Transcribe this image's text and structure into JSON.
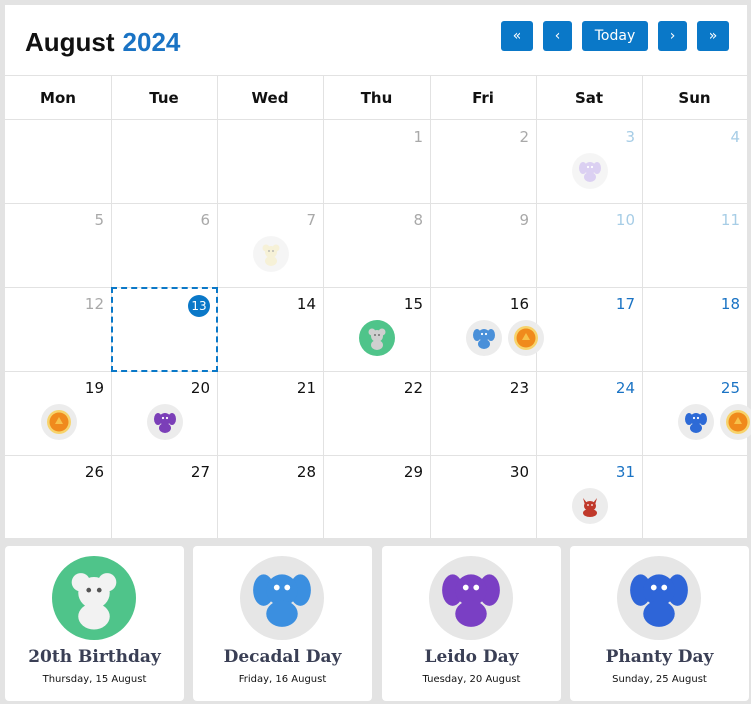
{
  "header": {
    "month": "August",
    "year": "2024",
    "buttons": {
      "first": "«",
      "prev": "‹",
      "today": "Today",
      "next": "›",
      "last": "»"
    }
  },
  "weekdays": [
    "Mon",
    "Tue",
    "Wed",
    "Thu",
    "Fri",
    "Sat",
    "Sun"
  ],
  "today_day": 13,
  "weeks": [
    [
      null,
      null,
      null,
      1,
      2,
      3,
      4
    ],
    [
      5,
      6,
      7,
      8,
      9,
      10,
      11
    ],
    [
      12,
      13,
      14,
      15,
      16,
      17,
      18
    ],
    [
      19,
      20,
      21,
      22,
      23,
      24,
      25
    ],
    [
      26,
      27,
      28,
      29,
      30,
      31,
      null
    ]
  ],
  "events": [
    {
      "day": 3,
      "icon": "purple-pet-icon",
      "color": "#b9a2e6"
    },
    {
      "day": 7,
      "icon": "yellow-bear-icon",
      "color": "#efe4b0"
    },
    {
      "day": 15,
      "icon": "bear-icon",
      "color": "#cfcfcf",
      "bg": "#4fc48a"
    },
    {
      "day": 16,
      "icon": "blue-pet-icon",
      "color": "#4a90d9"
    },
    {
      "day": 16,
      "icon": "orange-orb-icon",
      "color": "#f08a1c"
    },
    {
      "day": 19,
      "icon": "orange-orb-icon",
      "color": "#f08a1c"
    },
    {
      "day": 20,
      "icon": "purple-pet-icon",
      "color": "#7b3fb8"
    },
    {
      "day": 25,
      "icon": "blue-pet-icon",
      "color": "#2d6ad6"
    },
    {
      "day": 25,
      "icon": "orange-orb-icon",
      "color": "#f08a1c"
    },
    {
      "day": 31,
      "icon": "red-pet-icon",
      "color": "#c0392b"
    }
  ],
  "cards": [
    {
      "title": "20th Birthday",
      "date": "Thursday, 15 August",
      "icon": "bear-icon",
      "bg": "#4fc48a",
      "color": "#f2f2f2"
    },
    {
      "title": "Decadal Day",
      "date": "Friday, 16 August",
      "icon": "blue-pet-icon",
      "bg": "#e6e6e6",
      "color": "#3b8fe0"
    },
    {
      "title": "Leido Day",
      "date": "Tuesday, 20 August",
      "icon": "purple-pet-icon",
      "bg": "#e6e6e6",
      "color": "#7a3fc4"
    },
    {
      "title": "Phanty Day",
      "date": "Sunday, 25 August",
      "icon": "blue-pet-icon",
      "bg": "#e6e6e6",
      "color": "#2e65d8"
    }
  ]
}
